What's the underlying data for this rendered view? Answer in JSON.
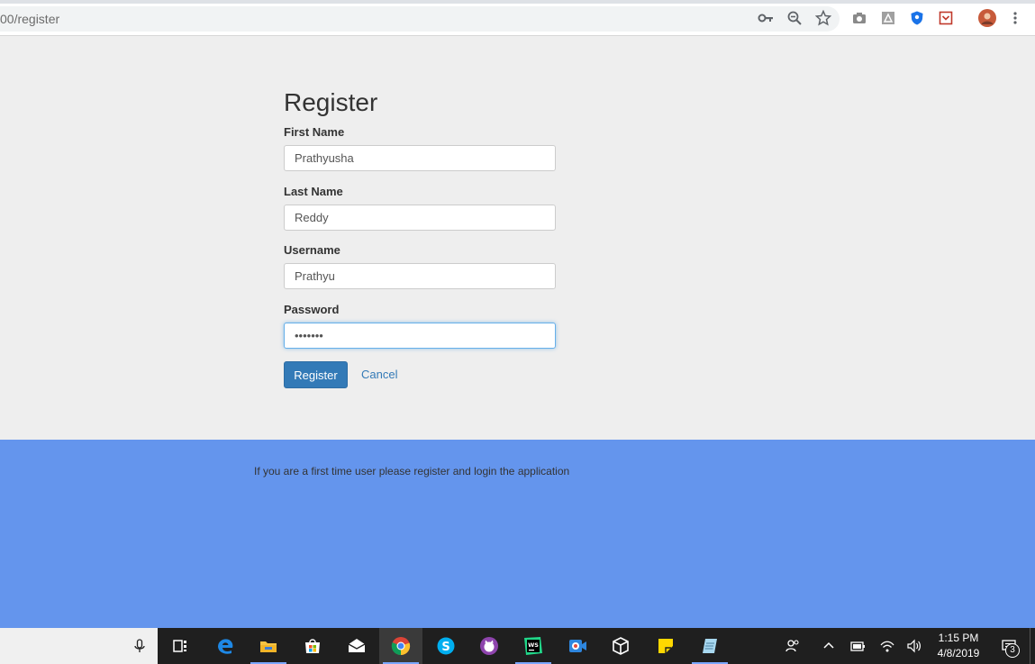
{
  "browser": {
    "url": "00/register",
    "icons": [
      "key-icon",
      "zoom-out-icon",
      "star-icon",
      "camera-icon",
      "pdf-icon",
      "shield-extension-icon",
      "pocket-extension-icon",
      "profile-avatar",
      "more-menu-icon"
    ]
  },
  "form": {
    "title": "Register",
    "first_name_label": "First Name",
    "first_name_value": "Prathyusha",
    "last_name_label": "Last Name",
    "last_name_value": "Reddy",
    "username_label": "Username",
    "username_value": "Prathyu",
    "password_label": "Password",
    "password_value": "•••••••",
    "register_button": "Register",
    "cancel_link": "Cancel"
  },
  "footer": {
    "text": "If you are a first time user please register and login the application"
  },
  "taskbar": {
    "apps": [
      "task-view-icon",
      "edge-icon",
      "file-explorer-icon",
      "store-icon",
      "mail-icon",
      "chrome-icon",
      "skype-icon",
      "app-cat-icon",
      "webstorm-icon",
      "screen-recorder-icon",
      "virtualbox-icon",
      "sticky-notes-icon",
      "notepad-icon"
    ],
    "time": "1:15 PM",
    "date": "4/8/2019",
    "notification_count": "3"
  },
  "colors": {
    "primary": "#337ab7",
    "footer_bg": "#6495ed",
    "page_bg": "#eeeeee",
    "taskbar_bg": "#1f1f1f"
  }
}
